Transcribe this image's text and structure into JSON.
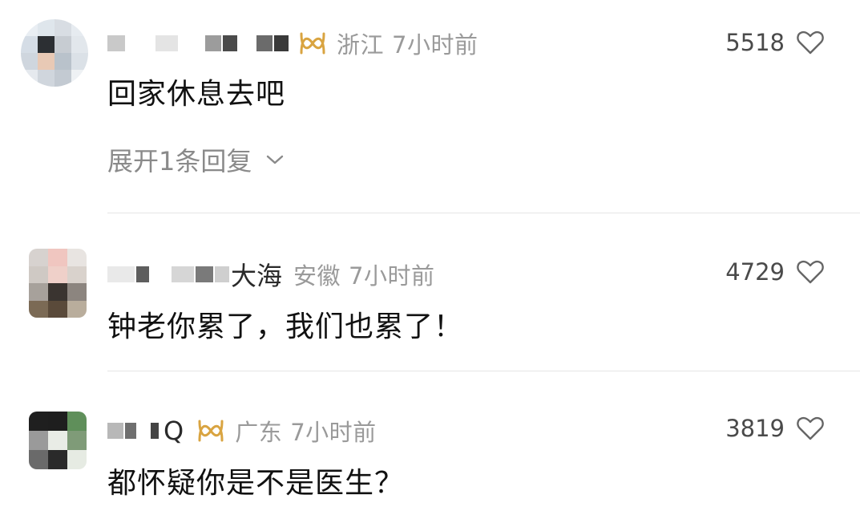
{
  "colors": {
    "meta_gray": "#9a9a9a",
    "badge_gold": "#d9a441",
    "divider": "#e6e6e6"
  },
  "comments": [
    {
      "name_visible": "",
      "location": "浙江",
      "time": "7小时前",
      "likes": "5518",
      "content": "回家休息去吧",
      "expand_label": "展开1条回复",
      "has_badge": true
    },
    {
      "name_visible": "大海",
      "location": "安徽",
      "time": "7小时前",
      "likes": "4729",
      "content": "钟老你累了，我们也累了！",
      "has_badge": false
    },
    {
      "name_visible": "Q",
      "location": "广东",
      "time": "7小时前",
      "likes": "3819",
      "content": "都怀疑你是不是医生？",
      "has_badge": true
    }
  ],
  "icons": {
    "like": "heart-outline-icon",
    "expand": "chevron-down-icon",
    "badge": "infinity-badge-icon"
  }
}
